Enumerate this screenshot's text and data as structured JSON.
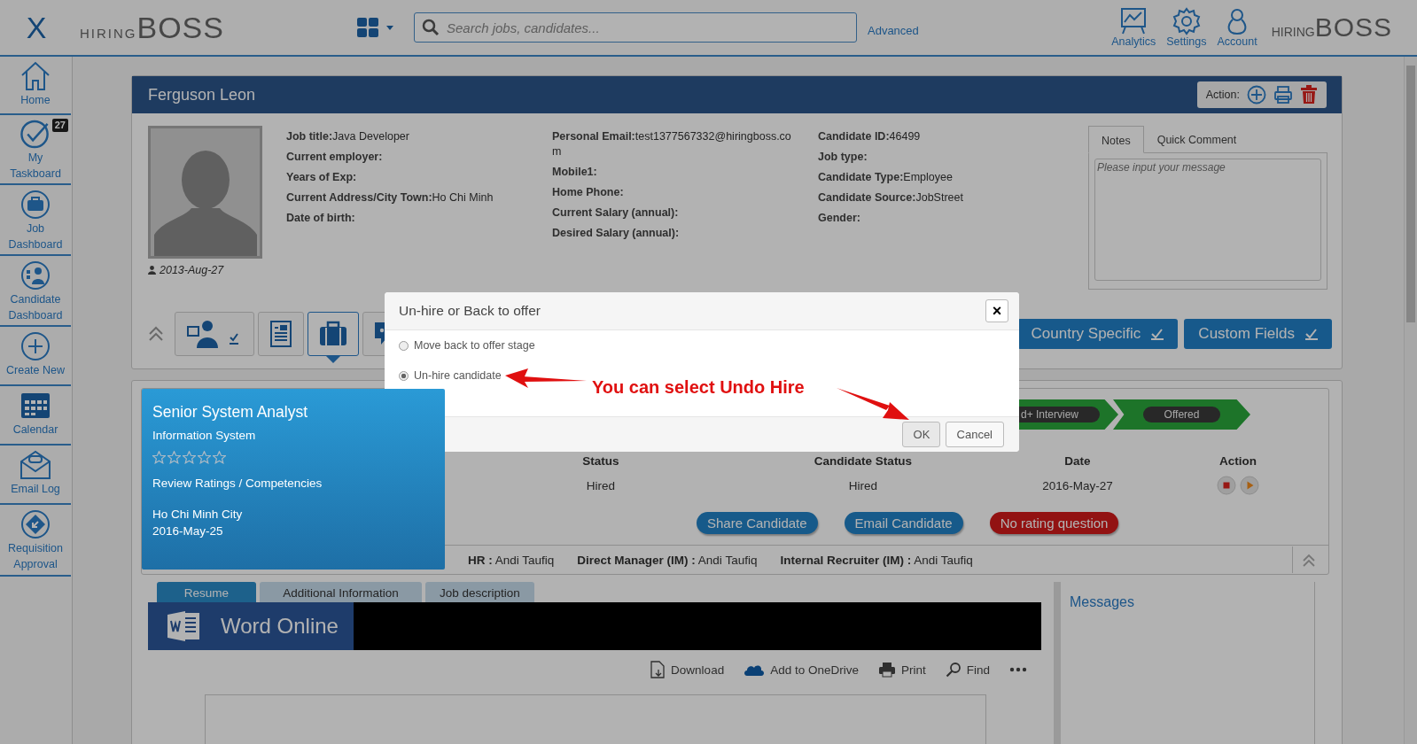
{
  "header": {
    "close": "X",
    "logo": {
      "small": "HIRING",
      "big": "BOSS"
    },
    "search": {
      "placeholder": "Search jobs, candidates..."
    },
    "advanced": "Advanced",
    "nav": [
      {
        "label": "Analytics",
        "kind": "analytics"
      },
      {
        "label": "Settings",
        "kind": "settings"
      },
      {
        "label": "Account",
        "kind": "account"
      }
    ],
    "logo_right": {
      "small": "HIRING",
      "big": "BOSS"
    }
  },
  "sidebar": {
    "items": [
      {
        "label": "Home",
        "kind": "home"
      },
      {
        "label": "My Taskboard",
        "kind": "check",
        "badge": "27"
      },
      {
        "label": "Job Dashboard",
        "kind": "briefcase"
      },
      {
        "label": "Candidate Dashboard",
        "kind": "people"
      },
      {
        "label": "Create New",
        "kind": "plus"
      },
      {
        "label": "Calendar",
        "kind": "calendar"
      },
      {
        "label": "Email Log",
        "kind": "envelope"
      },
      {
        "label": "Requisition Approval",
        "kind": "diamond"
      }
    ]
  },
  "candidate": {
    "name": "Ferguson Leon",
    "action_label": "Action:",
    "photo_date": "2013-Aug-27",
    "field_columns": [
      [
        {
          "label": "Job title:",
          "value": "Java Developer"
        },
        {
          "label": "Current employer:"
        },
        {
          "label": "Years of Exp:"
        },
        {
          "label": "Current Address/City Town:",
          "value": "Ho Chi Minh"
        },
        {
          "label": "Date of birth:"
        }
      ],
      [
        {
          "label": "Personal Email:",
          "value": "test1377567332@hiringboss.com"
        },
        {
          "label": "Mobile1:"
        },
        {
          "label": "Home Phone:"
        },
        {
          "label": "Current Salary (annual):"
        },
        {
          "label": "Desired Salary (annual):"
        }
      ],
      [
        {
          "label": "Candidate ID:",
          "value": "46499"
        },
        {
          "label": "Job type:"
        },
        {
          "label": "Candidate Type:",
          "value": "Employee"
        },
        {
          "label": "Candidate Source:",
          "value": "JobStreet"
        },
        {
          "label": "Gender:"
        }
      ]
    ],
    "notes": {
      "tabs": [
        {
          "label": "Notes",
          "selected": true
        },
        {
          "label": "Quick Comment",
          "selected": false
        }
      ],
      "placeholder": "Please input your message"
    },
    "tools": [
      {
        "kind": "person",
        "selected": false
      },
      {
        "kind": "document",
        "selected": false
      },
      {
        "kind": "briefcase",
        "selected": true
      },
      {
        "kind": "chat",
        "selected": false
      }
    ],
    "section_buttons": [
      {
        "label": "Country Specific"
      },
      {
        "label": "Custom Fields"
      }
    ]
  },
  "job": {
    "title": "Senior System Analyst",
    "department": "Information System",
    "stars": 0,
    "review": "Review Ratings / Competencies",
    "location": "Ho Chi Minh City",
    "date": "2016-May-25",
    "pipeline": [
      {
        "label": "d+ Interview"
      },
      {
        "label": "Offered"
      }
    ],
    "columns": [
      "Status",
      "Candidate Status",
      "Date",
      "Action"
    ],
    "row": {
      "status": "Hired",
      "candidate_status": "Hired",
      "date": "2016-May-27"
    },
    "buttons": [
      {
        "label": "Share Candidate",
        "kind": "primary"
      },
      {
        "label": "Email Candidate",
        "kind": "primary"
      },
      {
        "label": "No rating question",
        "kind": "danger"
      }
    ],
    "team": [
      {
        "label": "HR :",
        "value": "Andi Taufiq"
      },
      {
        "label": "Direct Manager (IM) :",
        "value": "Andi Taufiq"
      },
      {
        "label": "Internal Recruiter (IM) :",
        "value": "Andi Taufiq"
      }
    ]
  },
  "documents": {
    "tabs": [
      {
        "label": "Resume",
        "selected": true
      },
      {
        "label": "Additional Information",
        "selected": false
      },
      {
        "label": "Job description",
        "selected": false
      }
    ],
    "viewer": "Word Online",
    "actions": [
      {
        "label": "Download",
        "kind": "download"
      },
      {
        "label": "Add to OneDrive",
        "kind": "cloud"
      },
      {
        "label": "Print",
        "kind": "print"
      },
      {
        "label": "Find",
        "kind": "find"
      },
      {
        "kind": "more"
      }
    ],
    "messages": "Messages"
  },
  "modal": {
    "title": "Un-hire or Back to offer",
    "close": "×",
    "options": [
      {
        "label": "Move back to offer stage",
        "selected": false
      },
      {
        "label": "Un-hire candidate",
        "selected": true
      }
    ],
    "annotation": "You can select Undo Hire",
    "buttons": [
      {
        "label": "OK",
        "kind": "primary"
      },
      {
        "label": "Cancel",
        "kind": "default"
      }
    ]
  }
}
